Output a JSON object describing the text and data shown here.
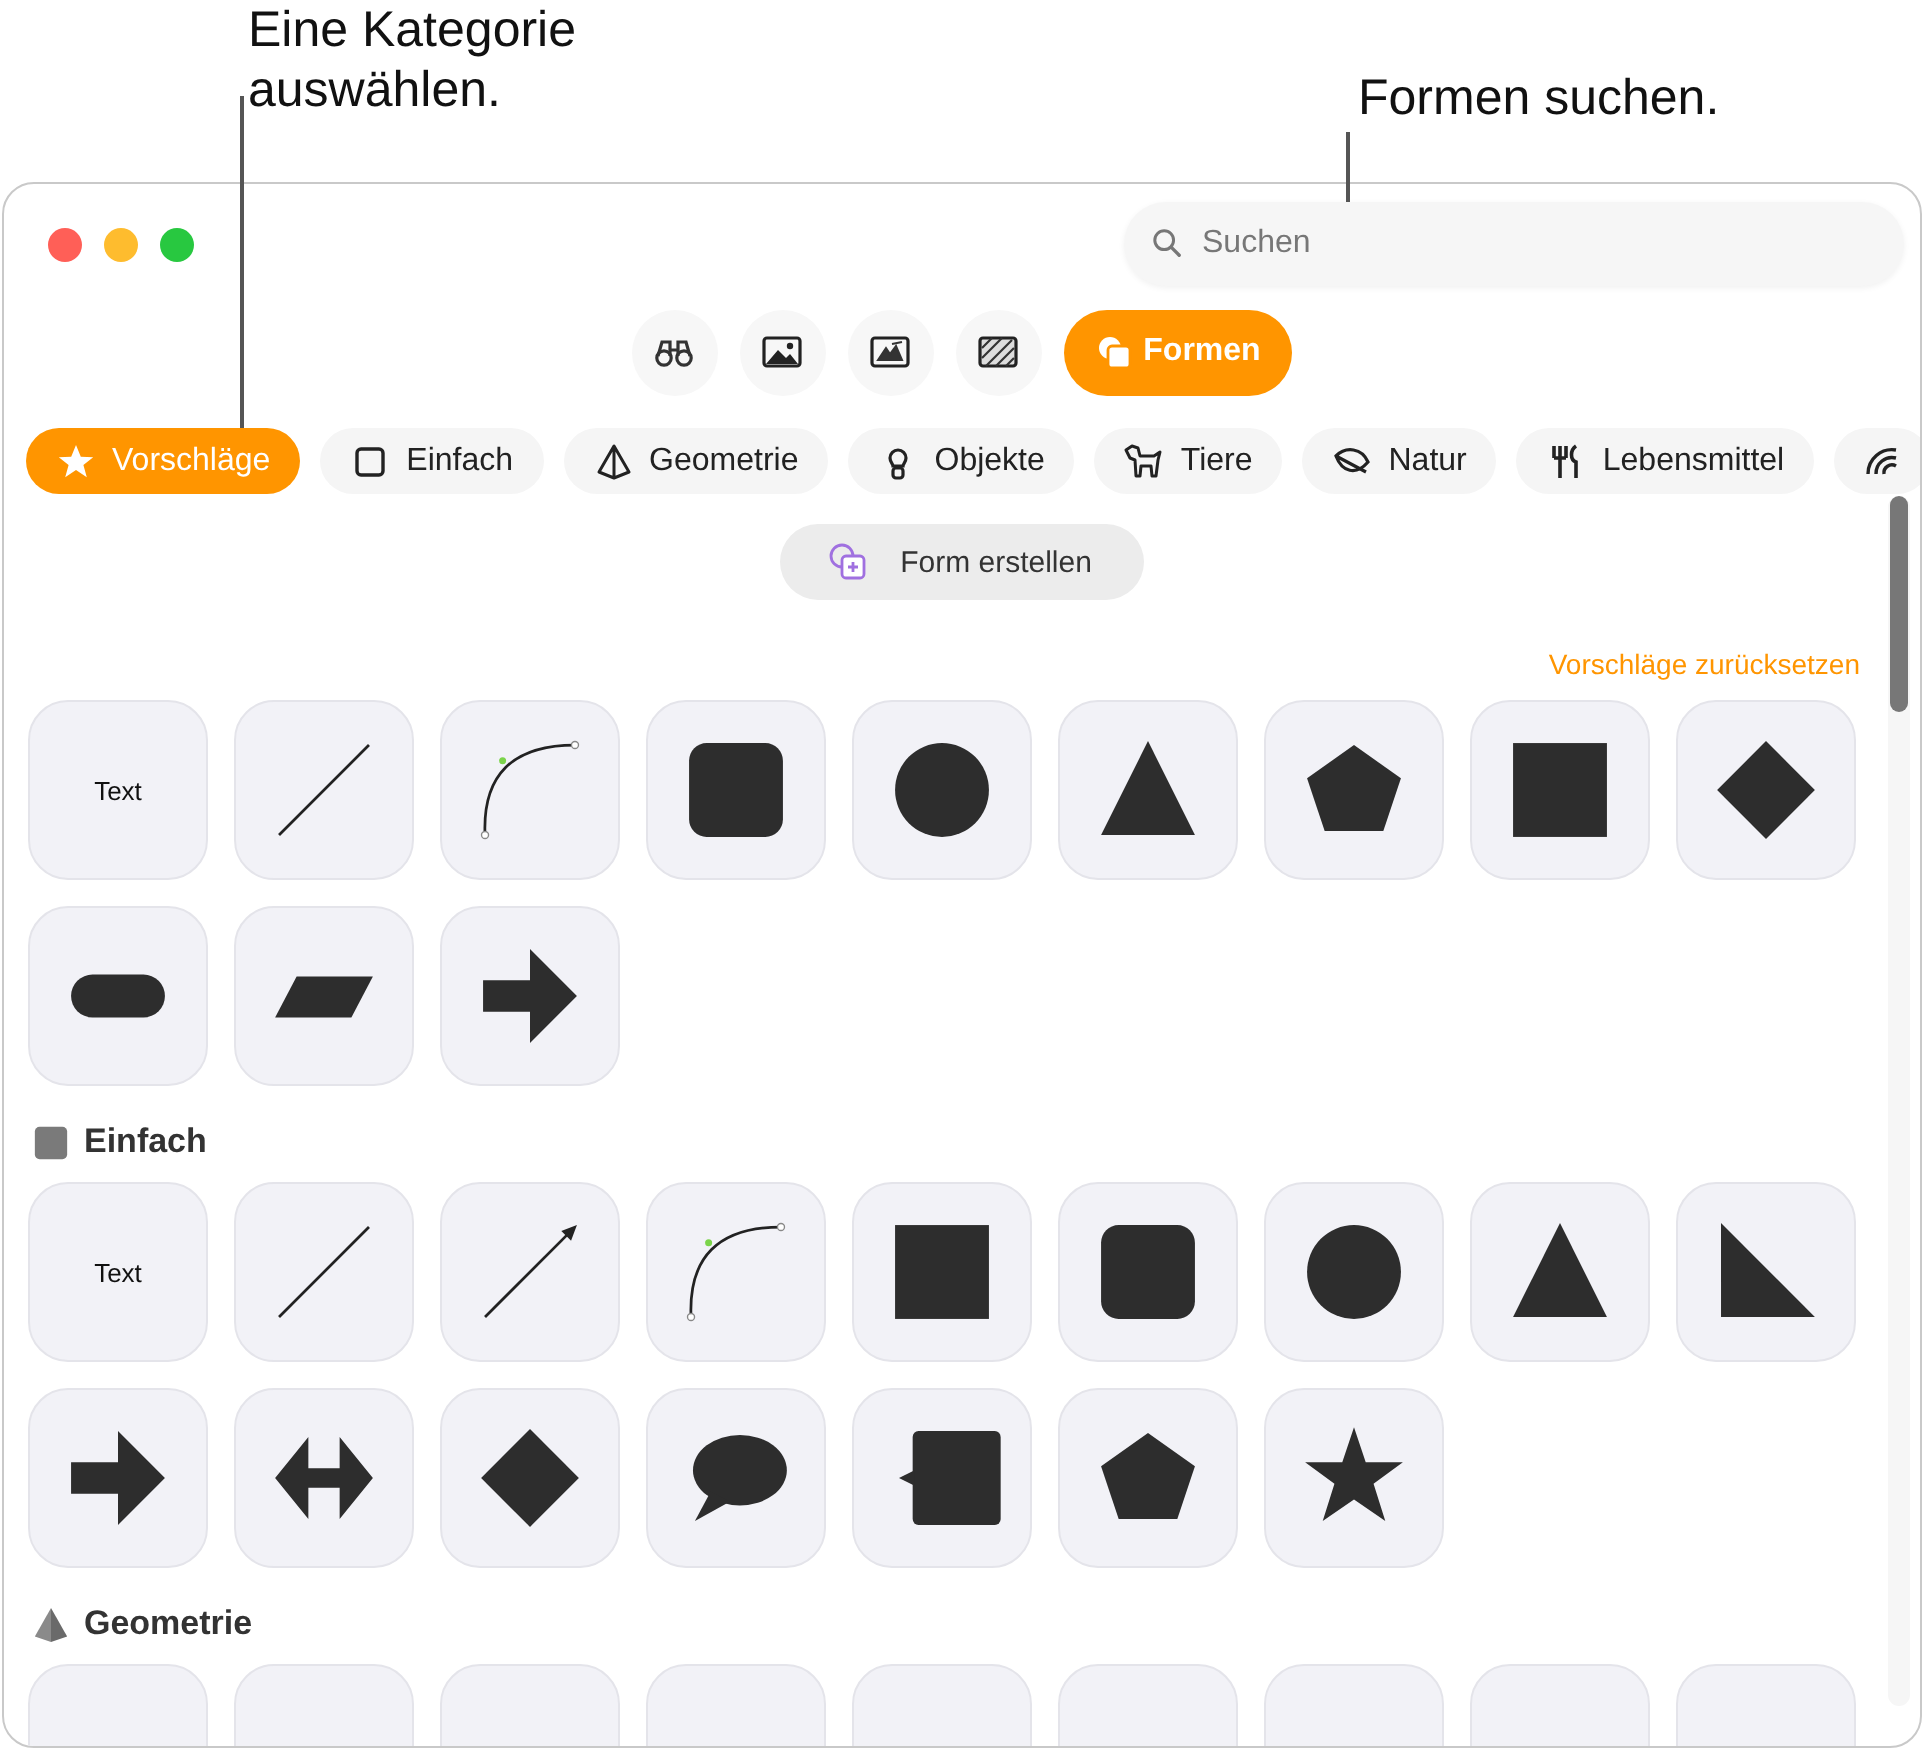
{
  "callouts": [
    {
      "text": "Eine Kategorie auswählen."
    },
    {
      "text": "Formen suchen."
    }
  ],
  "window": {
    "search": {
      "placeholder": "Suchen"
    },
    "toolbar": [
      {
        "kind": "binoculars",
        "selected": false
      },
      {
        "kind": "image",
        "selected": false
      },
      {
        "kind": "sticker",
        "selected": false
      },
      {
        "kind": "pattern",
        "selected": false
      },
      {
        "kind": "shapes",
        "label": "Formen",
        "selected": true
      }
    ],
    "categories": [
      {
        "kind": "star",
        "label": "Vorschläge",
        "selected": true
      },
      {
        "kind": "square",
        "label": "Einfach",
        "selected": false
      },
      {
        "kind": "pyramid",
        "label": "Geometrie",
        "selected": false
      },
      {
        "kind": "bulb",
        "label": "Objekte",
        "selected": false
      },
      {
        "kind": "dog",
        "label": "Tiere",
        "selected": false
      },
      {
        "kind": "leaf",
        "label": "Natur",
        "selected": false
      },
      {
        "kind": "fork",
        "label": "Lebensmittel",
        "selected": false
      },
      {
        "kind": "arcs",
        "selected": false
      }
    ],
    "create_button": "Form erstellen",
    "reset_link": "Vorschläge zurücksetzen",
    "sections": [
      {
        "shapes": [
          {
            "kind": "text",
            "label": "Text"
          },
          {
            "kind": "line"
          },
          {
            "kind": "curve"
          },
          {
            "kind": "rounded-square"
          },
          {
            "kind": "circle"
          },
          {
            "kind": "triangle"
          },
          {
            "kind": "pentagon"
          },
          {
            "kind": "square"
          },
          {
            "kind": "diamond"
          },
          {
            "kind": "pill"
          },
          {
            "kind": "parallelogram"
          },
          {
            "kind": "arrow"
          }
        ]
      },
      {
        "kind": "square",
        "title": "Einfach",
        "shapes": [
          {
            "kind": "text",
            "label": "Text"
          },
          {
            "kind": "line"
          },
          {
            "kind": "arrow-line"
          },
          {
            "kind": "curve"
          },
          {
            "kind": "square"
          },
          {
            "kind": "rounded-square"
          },
          {
            "kind": "circle"
          },
          {
            "kind": "triangle"
          },
          {
            "kind": "right-triangle"
          },
          {
            "kind": "arrow"
          },
          {
            "kind": "double-arrow"
          },
          {
            "kind": "diamond"
          },
          {
            "kind": "speech-bubble"
          },
          {
            "kind": "callout-square"
          },
          {
            "kind": "pentagon"
          },
          {
            "kind": "star"
          }
        ]
      },
      {
        "kind": "pyramid",
        "title": "Geometrie",
        "shapes": [
          {
            "kind": "cut"
          },
          {
            "kind": "cut"
          },
          {
            "kind": "cut"
          },
          {
            "kind": "cut"
          },
          {
            "kind": "cut"
          },
          {
            "kind": "cut"
          },
          {
            "kind": "cut"
          },
          {
            "kind": "cut"
          },
          {
            "kind": "cut"
          }
        ]
      }
    ]
  }
}
